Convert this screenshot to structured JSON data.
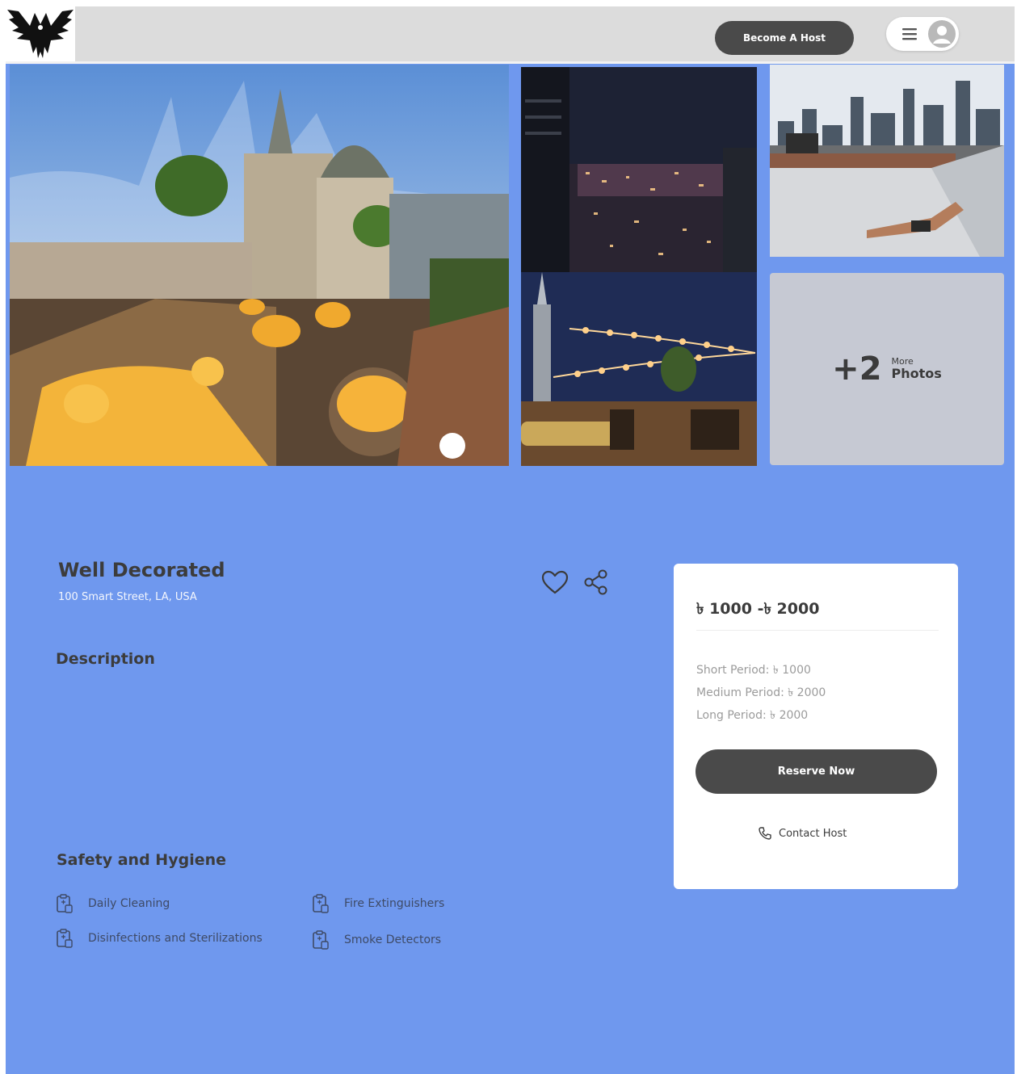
{
  "header": {
    "become_host_label": "Become A Host"
  },
  "gallery": {
    "more_count": "+2",
    "more_small": "More",
    "more_big": "Photos"
  },
  "listing": {
    "title": "Well Decorated",
    "address": "100 Smart Street, LA, USA",
    "description_heading": "Description",
    "safety_heading": "Safety and Hygiene",
    "amenities": [
      "Daily Cleaning",
      "Fire Extinguishers",
      "Disinfections and Sterilizations",
      "Smoke Detectors"
    ]
  },
  "pricing": {
    "range": "৳ 1000 -৳ 2000",
    "short": "Short Period: ৳ 1000",
    "medium": "Medium Period: ৳ 2000",
    "long": "Long Period: ৳ 2000",
    "reserve_label": "Reserve Now",
    "contact_label": "Contact Host"
  },
  "colors": {
    "page_bg": "#6f98ee",
    "header_bg": "#dcdcdc",
    "button_dark": "#4a4a4a",
    "card_bg": "#ffffff"
  },
  "icons": {
    "logo": "eagle-logo-icon",
    "menu": "hamburger-icon",
    "avatar": "user-avatar-icon",
    "favorite": "heart-icon",
    "share": "share-icon",
    "amenity": "clipboard-icon",
    "contact": "phone-icon"
  }
}
